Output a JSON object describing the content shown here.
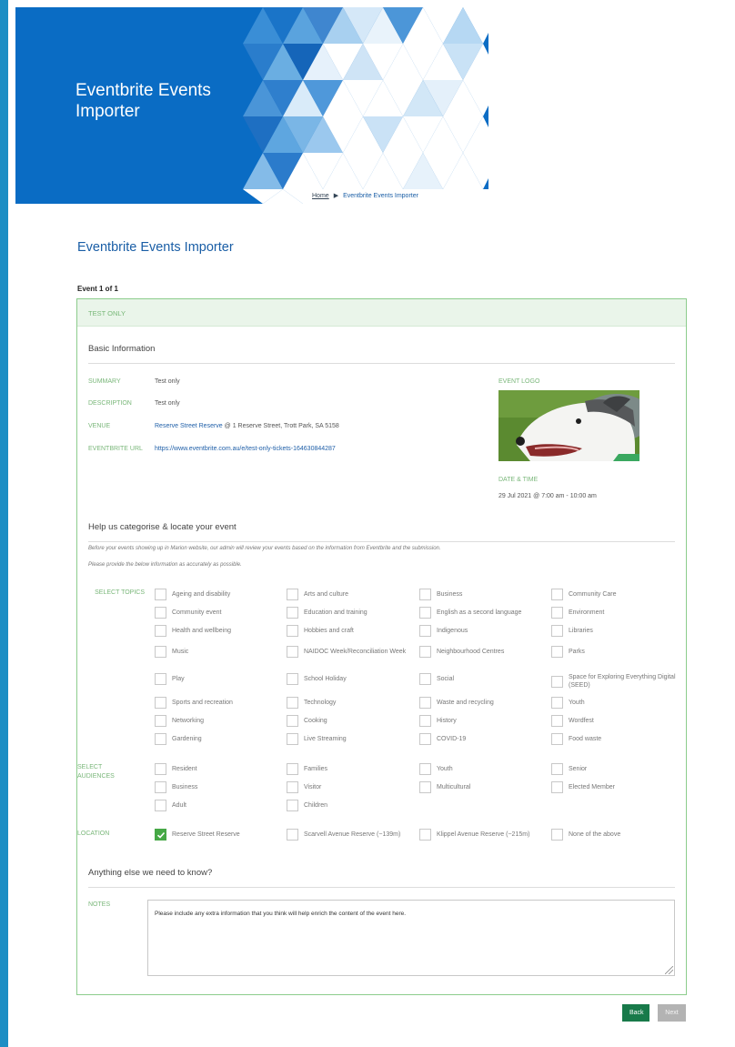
{
  "colors": {
    "brand_blue": "#0a6cc4",
    "sidebar_blue": "#1c8ec4",
    "label_green": "#7ab77a",
    "back_button": "#187a4a",
    "next_button": "#b3b3b3",
    "check_green": "#46a846"
  },
  "header": {
    "title": "Eventbrite Events Importer",
    "breadcrumb": {
      "home": "Home",
      "separator_icon": "triangle-right-icon",
      "current": "Eventbrite Events Importer"
    }
  },
  "page": {
    "heading": "Eventbrite Events Importer",
    "event_count": "Event 1 of 1"
  },
  "panel": {
    "event_title": "TEST ONLY",
    "basic_info": {
      "title": "Basic Information",
      "summary_label": "SUMMARY",
      "summary": "Test only",
      "description_label": "DESCRIPTION",
      "description": "Test only",
      "venue_label": "VENUE",
      "venue_name": "Reserve Street Reserve",
      "venue_address": "@ 1 Reserve Street, Trott Park, SA 5158",
      "url_label": "EVENTBRITE URL",
      "url": "https://www.eventbrite.com.au/e/test-only-tickets-164630844287",
      "logo_label": "EVENT LOGO",
      "datetime_label": "DATE & TIME",
      "datetime": "29 Jul 2021 @ 7:00 am - 10:00 am"
    },
    "categorise": {
      "title": "Help us categorise & locate your event",
      "note1": "Before your events showing up in Marion website, our admin will review your events based on the information from Eventbrite and the submission.",
      "note2": "Please provide the below information as accurately as possible.",
      "topics_label": "SELECT TOPICS",
      "topics": [
        "Ageing and disability",
        "Arts and culture",
        "Business",
        "Community Care",
        "Community event",
        "Education and training",
        "English as a second language",
        "Environment",
        "Health and wellbeing",
        "Hobbies and craft",
        "Indigenous",
        "Libraries",
        "Music",
        "NAIDOC Week/Reconciliation Week",
        "Neighbourhood Centres",
        "Parks",
        "Play",
        "School Holiday",
        "Social",
        "Space for Exploring Everything Digital (SEED)",
        "Sports and recreation",
        "Technology",
        "Waste and recycling",
        "Youth",
        "Networking",
        "Cooking",
        "History",
        "Wordfest",
        "Gardening",
        "Live Streaming",
        "COVID-19",
        "Food waste"
      ],
      "audiences_label": "SELECT AUDIENCES",
      "audiences": [
        "Resident",
        "Families",
        "Youth",
        "Senior",
        "Business",
        "Visitor",
        "Multicultural",
        "Elected Member",
        "Adult",
        "Children"
      ],
      "location_label": "LOCATION",
      "locations": [
        "Reserve Street Reserve",
        "Scarvell Avenue Reserve (~139m)",
        "Klippel Avenue Reserve (~215m)",
        "None of the above"
      ],
      "location_checked": "Reserve Street Reserve"
    },
    "extra": {
      "title": "Anything else we need to know?",
      "notes_label": "NOTES",
      "notes_placeholder": "Please include any extra information that you think will help enrich the content of the event here."
    }
  },
  "buttons": {
    "back": "Back",
    "next": "Next"
  }
}
